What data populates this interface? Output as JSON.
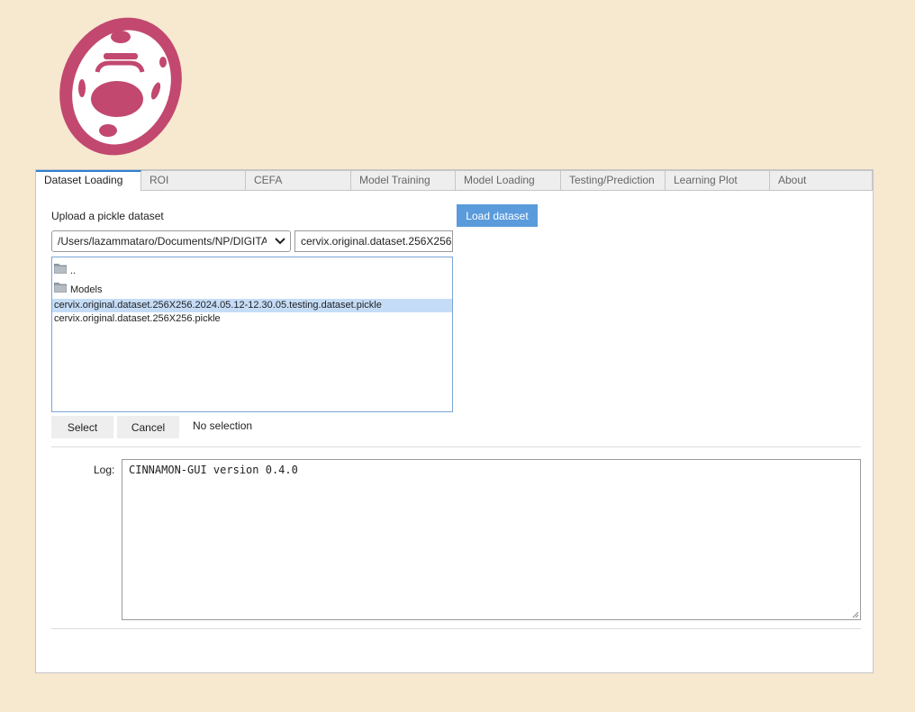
{
  "logo": {
    "name": "cinnamon-cell-logo",
    "color": "#c2486f"
  },
  "tabs": [
    {
      "label": "Dataset Loading",
      "active": true
    },
    {
      "label": "ROI",
      "active": false
    },
    {
      "label": "CEFA",
      "active": false
    },
    {
      "label": "Model Training",
      "active": false
    },
    {
      "label": "Model Loading",
      "active": false
    },
    {
      "label": "Testing/Prediction",
      "active": false
    },
    {
      "label": "Learning Plot",
      "active": false
    },
    {
      "label": "About",
      "active": false
    }
  ],
  "dataset": {
    "upload_label": "Upload a pickle dataset",
    "load_button": "Load dataset",
    "path_value": "/Users/lazammataro/Documents/NP/DIGITAL_",
    "filename_value": "cervix.original.dataset.256X256",
    "files": [
      {
        "name": "..",
        "type": "folder",
        "selected": false
      },
      {
        "name": "Models",
        "type": "folder",
        "selected": false
      },
      {
        "name": "cervix.original.dataset.256X256.2024.05.12-12.30.05.testing.dataset.pickle",
        "type": "file",
        "selected": true
      },
      {
        "name": "cervix.original.dataset.256X256.pickle",
        "type": "file",
        "selected": false
      }
    ],
    "select_button": "Select",
    "cancel_button": "Cancel",
    "selection_status": "No selection"
  },
  "log": {
    "label": "Log:",
    "text": "CINNAMON-GUI version 0.4.0"
  },
  "colors": {
    "background": "#f7e8d0",
    "accent": "#5a9bdc",
    "selection": "#c5dcf7"
  }
}
